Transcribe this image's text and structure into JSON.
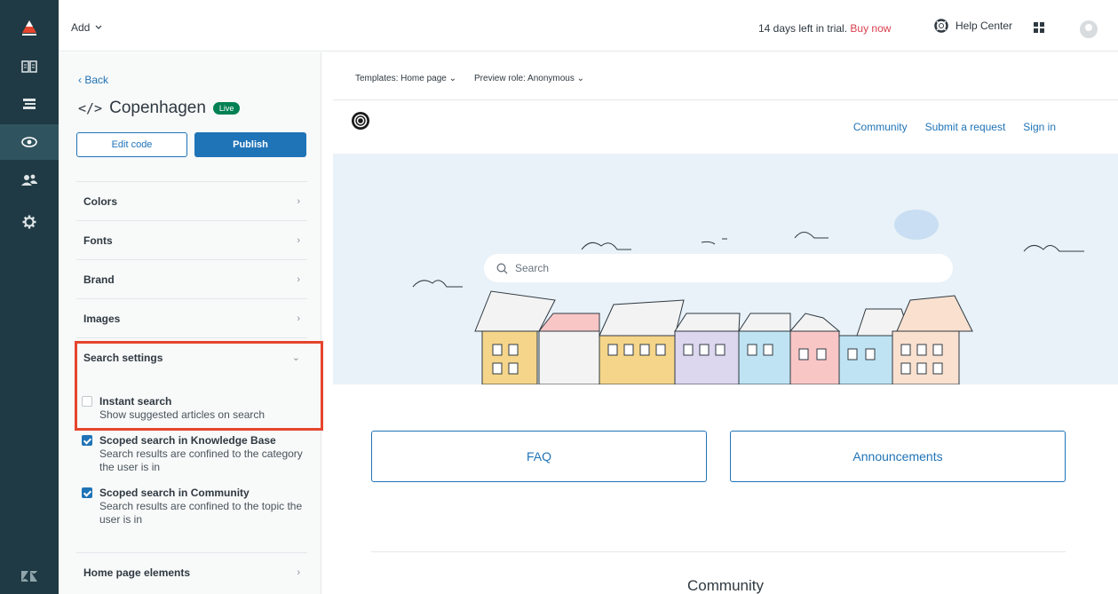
{
  "topbar": {
    "add_label": "Add",
    "trial_text": "14 days left in trial.",
    "buy_now": "Buy now",
    "help_center": "Help Center"
  },
  "rail": {
    "icons": [
      "zendesk-logo-icon",
      "guide-icon",
      "list-icon",
      "eye-icon",
      "users-icon",
      "gear-icon",
      "zendesk-z-icon"
    ],
    "active": "eye-icon"
  },
  "panel": {
    "back": "Back",
    "theme_name": "Copenhagen",
    "live_badge": "Live",
    "edit_code": "Edit code",
    "publish": "Publish",
    "sections": [
      "Colors",
      "Fonts",
      "Brand",
      "Images",
      "Search settings",
      "Home page elements"
    ],
    "search_settings": [
      {
        "title": "Instant search",
        "desc": "Show suggested articles on search",
        "checked": false
      },
      {
        "title": "Scoped search in Knowledge Base",
        "desc": "Search results are confined to the category the user is in",
        "checked": true
      },
      {
        "title": "Scoped search in Community",
        "desc": "Search results are confined to the topic the user is in",
        "checked": true
      }
    ]
  },
  "preview": {
    "templates_label": "Templates: Home page",
    "preview_role": "Preview role: Anonymous",
    "nav": [
      "Community",
      "Submit a request",
      "Sign in"
    ],
    "search_placeholder": "Search",
    "cards": [
      "FAQ",
      "Announcements"
    ],
    "community_heading": "Community"
  },
  "colors": {
    "rail_bg": "#1f3a44",
    "accent": "#1f73b7",
    "buy_now": "#d93f4c",
    "highlight": "#e5452d",
    "live_badge": "#038153"
  }
}
